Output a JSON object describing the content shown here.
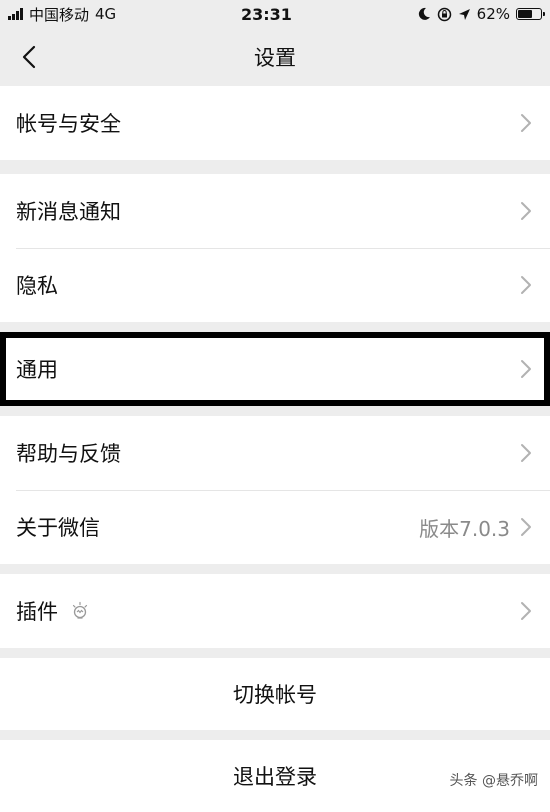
{
  "status_bar": {
    "carrier": "中国移动",
    "network": "4G",
    "time": "23:31",
    "battery": "62%",
    "battery_level": 0.62
  },
  "header": {
    "title": "设置"
  },
  "groups": [
    {
      "items": [
        {
          "label": "帐号与安全"
        }
      ]
    },
    {
      "items": [
        {
          "label": "新消息通知"
        },
        {
          "label": "隐私"
        }
      ]
    },
    {
      "items": [
        {
          "label": "通用"
        }
      ]
    },
    {
      "items": [
        {
          "label": "帮助与反馈"
        },
        {
          "label": "关于微信",
          "value": "版本7.0.3"
        }
      ]
    },
    {
      "items": [
        {
          "label": "插件"
        }
      ]
    }
  ],
  "actions": {
    "switch_account": "切换帐号",
    "logout": "退出登录"
  },
  "watermark": "头条 @悬乔啊",
  "colors": {
    "background": "#ededed",
    "card": "#ffffff",
    "highlight_border": "#000000",
    "secondary_text": "#8a8a8a"
  }
}
